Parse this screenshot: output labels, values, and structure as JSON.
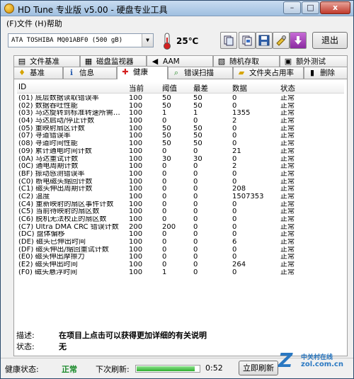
{
  "window": {
    "title": "HD Tune 专业版 v5.00 - 硬盘专业工具",
    "minimize": "–",
    "maximize": "□",
    "close": "x"
  },
  "menu": {
    "items": [
      "(F)文件",
      "(H)帮助"
    ]
  },
  "toolbar": {
    "drive": "ATA     TOSHIBA MQ01ABF0 (500 gB)",
    "temperature": "25℃",
    "buttons": [
      "copy-text-icon",
      "copy-screen-icon",
      "save-icon",
      "options-icon",
      "download-icon"
    ],
    "exit": "退出"
  },
  "tabs_top": [
    {
      "label": "文件基准",
      "icon": "file-benchmark-icon"
    },
    {
      "label": "磁盘监视器",
      "icon": "disk-monitor-icon"
    },
    {
      "label": "AAM",
      "icon": "speaker-icon"
    },
    {
      "label": "随机存取",
      "icon": "random-access-icon"
    },
    {
      "label": "额外测试",
      "icon": "extra-tests-icon"
    }
  ],
  "tabs_bottom": [
    {
      "label": "基准",
      "icon": "benchmark-icon"
    },
    {
      "label": "信息",
      "icon": "info-icon"
    },
    {
      "label": "健康",
      "icon": "health-cross-icon"
    },
    {
      "label": "错误扫描",
      "icon": "error-scan-icon"
    },
    {
      "label": "文件夹占用率",
      "icon": "folder-usage-icon"
    },
    {
      "label": "删除",
      "icon": "erase-icon"
    }
  ],
  "grid": {
    "headers": [
      "ID",
      "当前",
      "阈值",
      "最差",
      "数据",
      "状态"
    ],
    "rows": [
      {
        "id": "(01) 底层数据读取错误率",
        "cur": "100",
        "thr": "50",
        "worst": "50",
        "data": "0",
        "status": "正常"
      },
      {
        "id": "(02) 数据吞吐性能",
        "cur": "100",
        "thr": "50",
        "worst": "50",
        "data": "0",
        "status": "正常"
      },
      {
        "id": "(03) 马达旋转到标准转速所需…",
        "cur": "100",
        "thr": "1",
        "worst": "1",
        "data": "1355",
        "status": "正常"
      },
      {
        "id": "(04) 马达启动/停止计数",
        "cur": "100",
        "thr": "0",
        "worst": "0",
        "data": "2",
        "status": "正常"
      },
      {
        "id": "(05) 重映射扇区计数",
        "cur": "100",
        "thr": "50",
        "worst": "50",
        "data": "0",
        "status": "正常"
      },
      {
        "id": "(07) 寻道错误率",
        "cur": "100",
        "thr": "50",
        "worst": "50",
        "data": "0",
        "status": "正常"
      },
      {
        "id": "(08) 寻道时间性能",
        "cur": "100",
        "thr": "50",
        "worst": "50",
        "data": "0",
        "status": "正常"
      },
      {
        "id": "(09) 累计通电时间计数",
        "cur": "100",
        "thr": "0",
        "worst": "0",
        "data": "21",
        "status": "正常"
      },
      {
        "id": "(0A) 马达重试计数",
        "cur": "100",
        "thr": "30",
        "worst": "30",
        "data": "0",
        "status": "正常"
      },
      {
        "id": "(0C) 通电周期计数",
        "cur": "100",
        "thr": "0",
        "worst": "0",
        "data": "2",
        "status": "正常"
      },
      {
        "id": "(BF) 振动感测错误率",
        "cur": "100",
        "thr": "0",
        "worst": "0",
        "data": "0",
        "status": "正常"
      },
      {
        "id": "(C0) 断电磁头缩回计数",
        "cur": "100",
        "thr": "0",
        "worst": "0",
        "data": "0",
        "status": "正常"
      },
      {
        "id": "(C1) 磁头伸出周期计数",
        "cur": "100",
        "thr": "0",
        "worst": "0",
        "data": "208",
        "status": "正常"
      },
      {
        "id": "(C2) 温度",
        "cur": "100",
        "thr": "0",
        "worst": "0",
        "data": "1507353",
        "status": "正常"
      },
      {
        "id": "(C4) 重新映射的扇区事件计数",
        "cur": "100",
        "thr": "0",
        "worst": "0",
        "data": "0",
        "status": "正常"
      },
      {
        "id": "(C5) 当前待映射的扇区数",
        "cur": "100",
        "thr": "0",
        "worst": "0",
        "data": "0",
        "status": "正常"
      },
      {
        "id": "(C6) 脱机无法校正的扇区数",
        "cur": "100",
        "thr": "0",
        "worst": "0",
        "data": "0",
        "status": "正常"
      },
      {
        "id": "(C7) Ultra DMA CRC 错误计数",
        "cur": "200",
        "thr": "200",
        "worst": "0",
        "data": "0",
        "status": "正常"
      },
      {
        "id": "(DC) 盘体偏移",
        "cur": "100",
        "thr": "0",
        "worst": "0",
        "data": "0",
        "status": "正常"
      },
      {
        "id": "(DE) 磁头已伸出时间",
        "cur": "100",
        "thr": "0",
        "worst": "0",
        "data": "6",
        "status": "正常"
      },
      {
        "id": "(DF) 磁头伸出/缩回重试计数",
        "cur": "100",
        "thr": "0",
        "worst": "0",
        "data": "0",
        "status": "正常"
      },
      {
        "id": "(E0) 磁头伸出摩擦力",
        "cur": "100",
        "thr": "0",
        "worst": "0",
        "data": "0",
        "status": "正常"
      },
      {
        "id": "(E2) 磁头伸出时间",
        "cur": "100",
        "thr": "0",
        "worst": "0",
        "data": "264",
        "status": "正常"
      },
      {
        "id": "(F0) 磁头悬浮时间",
        "cur": "100",
        "thr": "1",
        "worst": "0",
        "data": "0",
        "status": "正常"
      }
    ]
  },
  "description": {
    "desc_label": "描述:",
    "desc_value": "在项目上点击可以获得更加详细的有关说明",
    "status_label": "状态:",
    "status_value": "无"
  },
  "statusbar": {
    "health_label": "健康状态:",
    "health_value": "正常",
    "next_refresh_label": "下次刷新:",
    "progress": 0.93,
    "time": "0:52",
    "refresh_button": "立即刷新"
  },
  "watermark": {
    "logo": "Z",
    "line1": "中关村在线",
    "line2": "zol.com.cn"
  },
  "colors": {
    "health_ok": "#1a8a2a",
    "progress": "#2fae2f",
    "watermark": "#2a78c2"
  }
}
